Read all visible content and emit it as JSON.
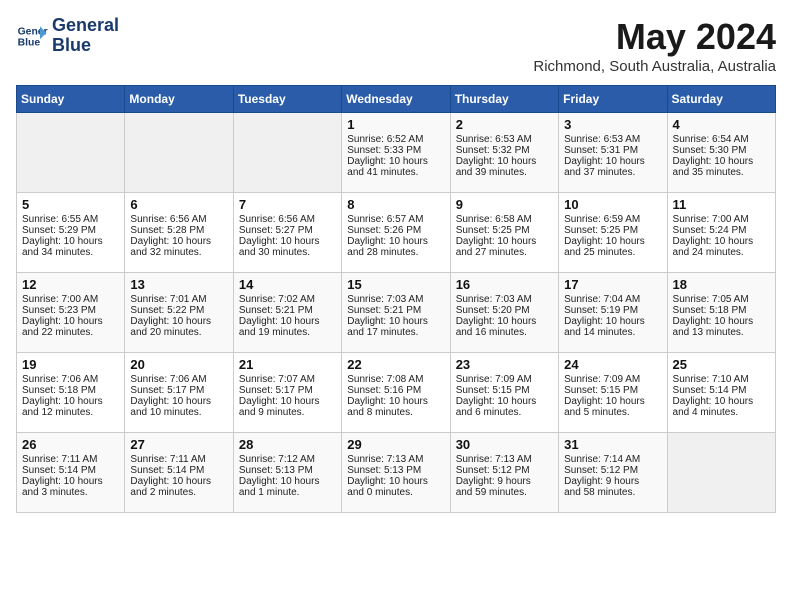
{
  "header": {
    "logo_line1": "General",
    "logo_line2": "Blue",
    "title": "May 2024",
    "location": "Richmond, South Australia, Australia"
  },
  "days_of_week": [
    "Sunday",
    "Monday",
    "Tuesday",
    "Wednesday",
    "Thursday",
    "Friday",
    "Saturday"
  ],
  "weeks": [
    [
      {
        "day": "",
        "empty": true
      },
      {
        "day": "",
        "empty": true
      },
      {
        "day": "",
        "empty": true
      },
      {
        "day": "1",
        "lines": [
          "Sunrise: 6:52 AM",
          "Sunset: 5:33 PM",
          "Daylight: 10 hours",
          "and 41 minutes."
        ]
      },
      {
        "day": "2",
        "lines": [
          "Sunrise: 6:53 AM",
          "Sunset: 5:32 PM",
          "Daylight: 10 hours",
          "and 39 minutes."
        ]
      },
      {
        "day": "3",
        "lines": [
          "Sunrise: 6:53 AM",
          "Sunset: 5:31 PM",
          "Daylight: 10 hours",
          "and 37 minutes."
        ]
      },
      {
        "day": "4",
        "lines": [
          "Sunrise: 6:54 AM",
          "Sunset: 5:30 PM",
          "Daylight: 10 hours",
          "and 35 minutes."
        ]
      }
    ],
    [
      {
        "day": "5",
        "lines": [
          "Sunrise: 6:55 AM",
          "Sunset: 5:29 PM",
          "Daylight: 10 hours",
          "and 34 minutes."
        ]
      },
      {
        "day": "6",
        "lines": [
          "Sunrise: 6:56 AM",
          "Sunset: 5:28 PM",
          "Daylight: 10 hours",
          "and 32 minutes."
        ]
      },
      {
        "day": "7",
        "lines": [
          "Sunrise: 6:56 AM",
          "Sunset: 5:27 PM",
          "Daylight: 10 hours",
          "and 30 minutes."
        ]
      },
      {
        "day": "8",
        "lines": [
          "Sunrise: 6:57 AM",
          "Sunset: 5:26 PM",
          "Daylight: 10 hours",
          "and 28 minutes."
        ]
      },
      {
        "day": "9",
        "lines": [
          "Sunrise: 6:58 AM",
          "Sunset: 5:25 PM",
          "Daylight: 10 hours",
          "and 27 minutes."
        ]
      },
      {
        "day": "10",
        "lines": [
          "Sunrise: 6:59 AM",
          "Sunset: 5:25 PM",
          "Daylight: 10 hours",
          "and 25 minutes."
        ]
      },
      {
        "day": "11",
        "lines": [
          "Sunrise: 7:00 AM",
          "Sunset: 5:24 PM",
          "Daylight: 10 hours",
          "and 24 minutes."
        ]
      }
    ],
    [
      {
        "day": "12",
        "lines": [
          "Sunrise: 7:00 AM",
          "Sunset: 5:23 PM",
          "Daylight: 10 hours",
          "and 22 minutes."
        ]
      },
      {
        "day": "13",
        "lines": [
          "Sunrise: 7:01 AM",
          "Sunset: 5:22 PM",
          "Daylight: 10 hours",
          "and 20 minutes."
        ]
      },
      {
        "day": "14",
        "lines": [
          "Sunrise: 7:02 AM",
          "Sunset: 5:21 PM",
          "Daylight: 10 hours",
          "and 19 minutes."
        ]
      },
      {
        "day": "15",
        "lines": [
          "Sunrise: 7:03 AM",
          "Sunset: 5:21 PM",
          "Daylight: 10 hours",
          "and 17 minutes."
        ]
      },
      {
        "day": "16",
        "lines": [
          "Sunrise: 7:03 AM",
          "Sunset: 5:20 PM",
          "Daylight: 10 hours",
          "and 16 minutes."
        ]
      },
      {
        "day": "17",
        "lines": [
          "Sunrise: 7:04 AM",
          "Sunset: 5:19 PM",
          "Daylight: 10 hours",
          "and 14 minutes."
        ]
      },
      {
        "day": "18",
        "lines": [
          "Sunrise: 7:05 AM",
          "Sunset: 5:18 PM",
          "Daylight: 10 hours",
          "and 13 minutes."
        ]
      }
    ],
    [
      {
        "day": "19",
        "lines": [
          "Sunrise: 7:06 AM",
          "Sunset: 5:18 PM",
          "Daylight: 10 hours",
          "and 12 minutes."
        ]
      },
      {
        "day": "20",
        "lines": [
          "Sunrise: 7:06 AM",
          "Sunset: 5:17 PM",
          "Daylight: 10 hours",
          "and 10 minutes."
        ]
      },
      {
        "day": "21",
        "lines": [
          "Sunrise: 7:07 AM",
          "Sunset: 5:17 PM",
          "Daylight: 10 hours",
          "and 9 minutes."
        ]
      },
      {
        "day": "22",
        "lines": [
          "Sunrise: 7:08 AM",
          "Sunset: 5:16 PM",
          "Daylight: 10 hours",
          "and 8 minutes."
        ]
      },
      {
        "day": "23",
        "lines": [
          "Sunrise: 7:09 AM",
          "Sunset: 5:15 PM",
          "Daylight: 10 hours",
          "and 6 minutes."
        ]
      },
      {
        "day": "24",
        "lines": [
          "Sunrise: 7:09 AM",
          "Sunset: 5:15 PM",
          "Daylight: 10 hours",
          "and 5 minutes."
        ]
      },
      {
        "day": "25",
        "lines": [
          "Sunrise: 7:10 AM",
          "Sunset: 5:14 PM",
          "Daylight: 10 hours",
          "and 4 minutes."
        ]
      }
    ],
    [
      {
        "day": "26",
        "lines": [
          "Sunrise: 7:11 AM",
          "Sunset: 5:14 PM",
          "Daylight: 10 hours",
          "and 3 minutes."
        ]
      },
      {
        "day": "27",
        "lines": [
          "Sunrise: 7:11 AM",
          "Sunset: 5:14 PM",
          "Daylight: 10 hours",
          "and 2 minutes."
        ]
      },
      {
        "day": "28",
        "lines": [
          "Sunrise: 7:12 AM",
          "Sunset: 5:13 PM",
          "Daylight: 10 hours",
          "and 1 minute."
        ]
      },
      {
        "day": "29",
        "lines": [
          "Sunrise: 7:13 AM",
          "Sunset: 5:13 PM",
          "Daylight: 10 hours",
          "and 0 minutes."
        ]
      },
      {
        "day": "30",
        "lines": [
          "Sunrise: 7:13 AM",
          "Sunset: 5:12 PM",
          "Daylight: 9 hours",
          "and 59 minutes."
        ]
      },
      {
        "day": "31",
        "lines": [
          "Sunrise: 7:14 AM",
          "Sunset: 5:12 PM",
          "Daylight: 9 hours",
          "and 58 minutes."
        ]
      },
      {
        "day": "",
        "empty": true
      }
    ]
  ]
}
